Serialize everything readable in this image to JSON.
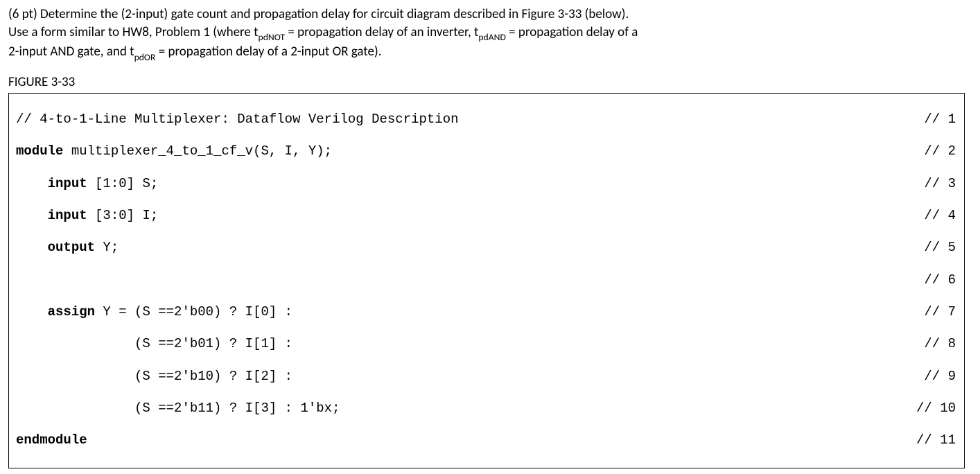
{
  "question": {
    "p1a": "(6 pt) Determine the (2-input) gate count and propagation delay for circuit diagram described in Figure 3-33 (below).",
    "p2a": "Use a form similar to HW8, Problem 1 (where t",
    "p2b": "pdNOT",
    "p2c": " = propagation delay of an inverter, t",
    "p2d": "pdAND",
    "p2e": " = propagation delay of a",
    "p3a": "2-input AND gate, and t",
    "p3b": "pdOR",
    "p3c": " = propagation delay of a 2-input OR gate)."
  },
  "figure_label": "FIGURE 3-33",
  "code": {
    "l1_text": "// 4-to-1-Line Multiplexer: Dataflow Verilog Description",
    "l1_num": "// 1",
    "l2_kw": "module",
    "l2_text": " multiplexer_4_to_1_cf_v(S, I, Y);",
    "l2_num": "// 2",
    "l3_pad": "    ",
    "l3_kw": "input",
    "l3_text": " [1:0] S;",
    "l3_num": "// 3",
    "l4_pad": "    ",
    "l4_kw": "input",
    "l4_text": " [3:0] I;",
    "l4_num": "// 4",
    "l5_pad": "    ",
    "l5_kw": "output",
    "l5_text": " Y;",
    "l5_num": "// 5",
    "l6_text": "",
    "l6_num": "// 6",
    "l7_pad": "    ",
    "l7_kw": "assign",
    "l7_text": " Y = (S ==2'b00) ? I[0] :",
    "l7_num": "// 7",
    "l8_text": "               (S ==2'b01) ? I[1] :",
    "l8_num": "// 8",
    "l9_text": "               (S ==2'b10) ? I[2] :",
    "l9_num": "// 9",
    "l10_text": "               (S ==2'b11) ? I[3] : 1'bx;",
    "l10_num": "// 10",
    "l11_kw": "endmodule",
    "l11_num": "// 11"
  }
}
